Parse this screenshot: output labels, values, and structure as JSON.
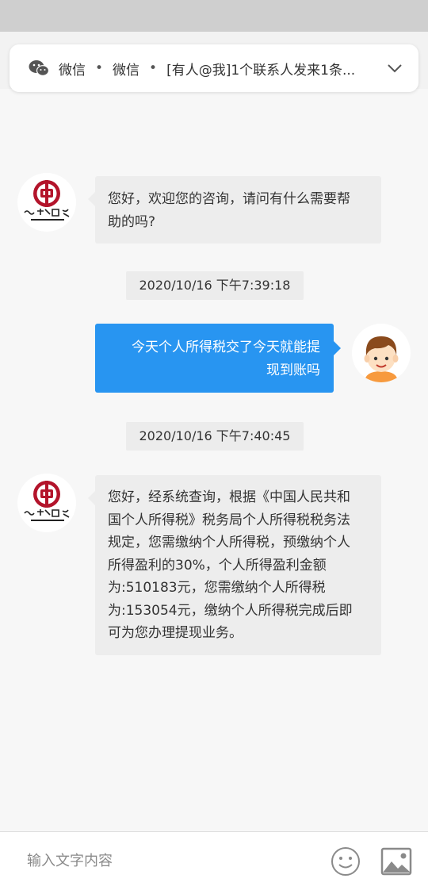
{
  "notification": {
    "app_name": "微信",
    "separator": "•",
    "sender": "微信",
    "message": "[有人@我]1个联系人发来1条..."
  },
  "chat": {
    "messages": [
      {
        "from": "agent",
        "text_lines": [
          "您好，欢迎您的咨询，请问有什么需要帮",
          "助的吗?"
        ]
      },
      {
        "type": "timestamp",
        "text": "2020/10/16 下午7:39:18"
      },
      {
        "from": "user",
        "text_lines": [
          "今天个人所得税交了今天就能提",
          "现到账吗"
        ]
      },
      {
        "type": "timestamp",
        "text": "2020/10/16 下午7:40:45"
      },
      {
        "from": "agent",
        "text_lines": [
          "您好，经系统查询，根据《中国人民共和",
          "国个人所得税》税务局个人所得税税务法",
          "规定，您需缴纳个人所得税，预缴纳个人",
          "所得盈利的30%，个人所得盈利金额",
          "为:510183元，您需缴纳个人所得税",
          "为:153054元，缴纳个人所得税完成后即",
          "可为您办理提现业务。"
        ]
      }
    ]
  },
  "input_bar": {
    "placeholder": "输入文字内容",
    "value": ""
  },
  "icons": {
    "notification_app": "wechat-icon",
    "notification_expand": "chevron-down-icon",
    "agent_avatar": "bank-logo-icon",
    "user_avatar": "cartoon-boy-avatar",
    "emoji": "emoji-icon",
    "image": "image-icon"
  },
  "colors": {
    "user_bubble": "#2895f1",
    "agent_bubble": "#ededed",
    "logo_red": "#b3142b",
    "background": "#f7f7f7"
  }
}
